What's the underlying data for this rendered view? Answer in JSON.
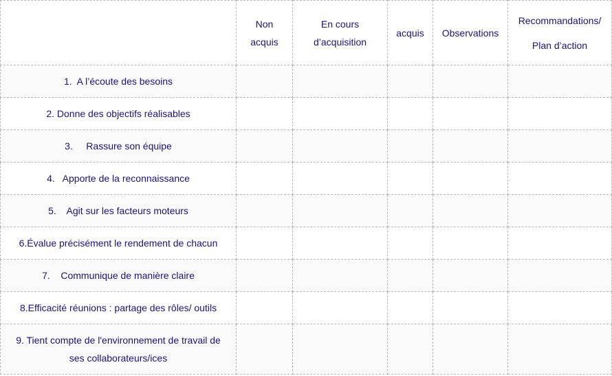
{
  "table": {
    "headers": {
      "criteria": "",
      "non_acquis": [
        "Non",
        "acquis"
      ],
      "en_cours": [
        "En cours",
        "d’acquisition"
      ],
      "acquis": "acquis",
      "observations": "Observations",
      "recommandations": [
        "Recommandations/",
        "Plan d’action"
      ]
    },
    "rows": [
      {
        "criterion": [
          "1.  A l’écoute des besoins"
        ],
        "non_acquis": "",
        "en_cours": "",
        "acquis": "",
        "observations": "",
        "recommandations": ""
      },
      {
        "criterion": [
          "2. Donne des objectifs réalisables"
        ],
        "non_acquis": "",
        "en_cours": "",
        "acquis": "",
        "observations": "",
        "recommandations": ""
      },
      {
        "criterion": [
          "3.     Rassure son équipe"
        ],
        "non_acquis": "",
        "en_cours": "",
        "acquis": "",
        "observations": "",
        "recommandations": ""
      },
      {
        "criterion": [
          "4.   Apporte de la reconnaissance"
        ],
        "non_acquis": "",
        "en_cours": "",
        "acquis": "",
        "observations": "",
        "recommandations": ""
      },
      {
        "criterion": [
          "5.    Agit sur les facteurs moteurs"
        ],
        "non_acquis": "",
        "en_cours": "",
        "acquis": "",
        "observations": "",
        "recommandations": ""
      },
      {
        "criterion": [
          "6.Évalue précisément le rendement de chacun"
        ],
        "non_acquis": "",
        "en_cours": "",
        "acquis": "",
        "observations": "",
        "recommandations": ""
      },
      {
        "criterion": [
          "7.    Communique de manière claire"
        ],
        "non_acquis": "",
        "en_cours": "",
        "acquis": "",
        "observations": "",
        "recommandations": ""
      },
      {
        "criterion": [
          "8.Efficacité réunions : partage des rôles/ outils"
        ],
        "non_acquis": "",
        "en_cours": "",
        "acquis": "",
        "observations": "",
        "recommandations": ""
      },
      {
        "criterion": [
          "9. Tient compte de l'environnement de travail de",
          "ses collaborateurs/ices"
        ],
        "non_acquis": "",
        "en_cours": "",
        "acquis": "",
        "observations": "",
        "recommandations": ""
      }
    ]
  }
}
